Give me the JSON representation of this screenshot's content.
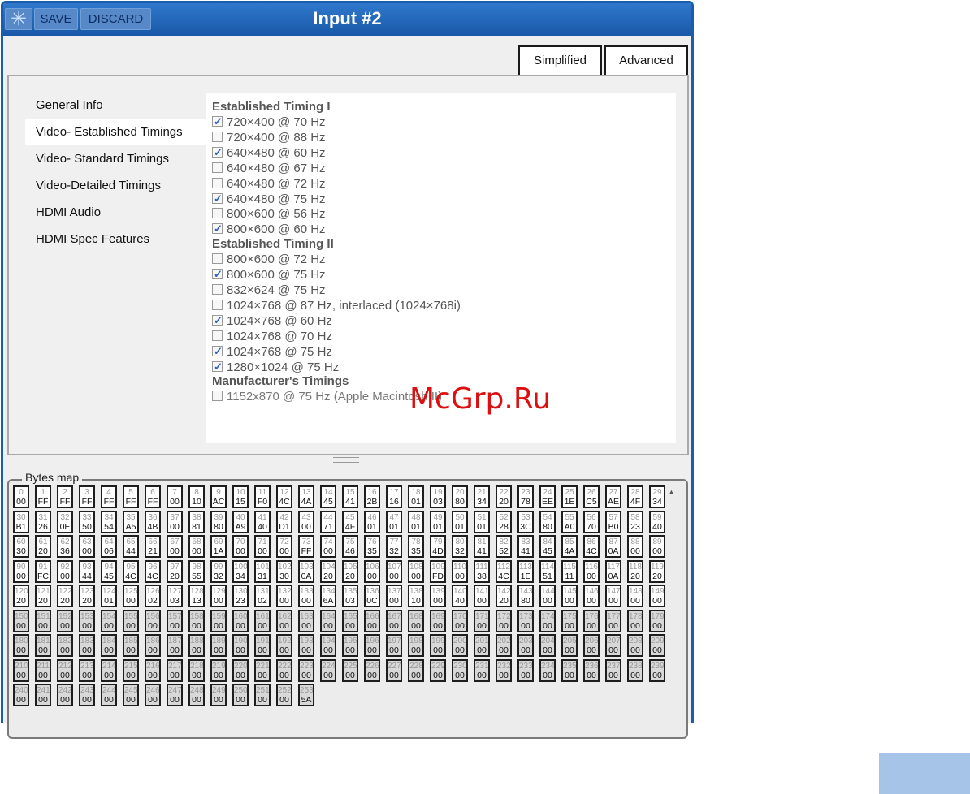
{
  "window": {
    "title": "Input #2",
    "save_label": "SAVE",
    "discard_label": "DISCARD",
    "asterisk": "✳"
  },
  "tabs": {
    "simplified": "Simplified",
    "advanced": "Advanced"
  },
  "nav": {
    "items": [
      {
        "label": "General Info",
        "active": false
      },
      {
        "label": "Video- Established Timings",
        "active": true
      },
      {
        "label": "Video- Standard Timings",
        "active": false
      },
      {
        "label": "Video-Detailed Timings",
        "active": false
      },
      {
        "label": "HDMI Audio",
        "active": false
      },
      {
        "label": "HDMI Spec Features",
        "active": false
      }
    ]
  },
  "timings": {
    "sections": [
      {
        "title": "Established Timing I",
        "options": [
          {
            "label": "720×400 @ 70 Hz",
            "checked": true
          },
          {
            "label": "720×400 @ 88 Hz",
            "checked": false
          },
          {
            "label": "640×480 @ 60 Hz",
            "checked": true
          },
          {
            "label": "640×480 @ 67 Hz",
            "checked": false
          },
          {
            "label": "640×480 @ 72 Hz",
            "checked": false
          },
          {
            "label": "640×480 @ 75 Hz",
            "checked": true
          },
          {
            "label": "800×600 @ 56 Hz",
            "checked": false
          },
          {
            "label": "800×600 @ 60 Hz",
            "checked": true
          }
        ]
      },
      {
        "title": "Established Timing II",
        "options": [
          {
            "label": "800×600 @ 72 Hz",
            "checked": false
          },
          {
            "label": "800×600 @ 75 Hz",
            "checked": true
          },
          {
            "label": "832×624 @ 75 Hz",
            "checked": false
          },
          {
            "label": "1024×768 @ 87 Hz, interlaced (1024×768i)",
            "checked": false
          },
          {
            "label": "1024×768 @ 60 Hz",
            "checked": true
          },
          {
            "label": "1024×768 @ 70 Hz",
            "checked": false
          },
          {
            "label": "1024×768 @ 75 Hz",
            "checked": true
          },
          {
            "label": "1280×1024 @ 75 Hz",
            "checked": true
          }
        ]
      },
      {
        "title": "Manufacturer's Timings",
        "options": [
          {
            "label": "1152x870 @ 75 Hz (Apple Macintosh II)",
            "checked": false,
            "disabled": true
          }
        ]
      }
    ]
  },
  "bytes_map": {
    "legend": "Bytes map",
    "highlight_white": [
      35,
      36,
      37
    ],
    "values": [
      "00",
      "FF",
      "FF",
      "FF",
      "FF",
      "FF",
      "FF",
      "00",
      "10",
      "AC",
      "15",
      "F0",
      "4C",
      "4A",
      "45",
      "41",
      "2B",
      "16",
      "01",
      "03",
      "80",
      "34",
      "20",
      "78",
      "EE",
      "1E",
      "C5",
      "AE",
      "4F",
      "34",
      "B1",
      "26",
      "0E",
      "50",
      "54",
      "A5",
      "4B",
      "00",
      "81",
      "80",
      "A9",
      "40",
      "D1",
      "00",
      "71",
      "4F",
      "01",
      "01",
      "01",
      "01",
      "01",
      "01",
      "28",
      "3C",
      "80",
      "A0",
      "70",
      "B0",
      "23",
      "40",
      "30",
      "20",
      "36",
      "00",
      "06",
      "44",
      "21",
      "00",
      "00",
      "1A",
      "00",
      "00",
      "00",
      "FF",
      "00",
      "46",
      "35",
      "32",
      "35",
      "4D",
      "32",
      "41",
      "52",
      "41",
      "45",
      "4A",
      "4C",
      "0A",
      "00",
      "00",
      "00",
      "FC",
      "00",
      "44",
      "45",
      "4C",
      "4C",
      "20",
      "55",
      "32",
      "34",
      "31",
      "30",
      "0A",
      "20",
      "20",
      "00",
      "00",
      "00",
      "FD",
      "00",
      "38",
      "4C",
      "1E",
      "51",
      "11",
      "00",
      "0A",
      "20",
      "20",
      "20",
      "20",
      "20",
      "20",
      "01",
      "00",
      "02",
      "03",
      "13",
      "00",
      "23",
      "02",
      "00",
      "00",
      "6A",
      "03",
      "0C",
      "00",
      "10",
      "00",
      "40",
      "00",
      "20",
      "80",
      "00",
      "00",
      "00",
      "00",
      "00",
      "00",
      "00",
      "00",
      "00",
      "00",
      "00",
      "00",
      "00",
      "00",
      "00",
      "00",
      "00",
      "00",
      "00",
      "00",
      "00",
      "00",
      "00",
      "00",
      "00",
      "00",
      "00",
      "00",
      "00",
      "00",
      "00",
      "00",
      "00",
      "00",
      "00",
      "00",
      "00",
      "00",
      "00",
      "00",
      "00",
      "00",
      "00",
      "00",
      "00",
      "00",
      "00",
      "00",
      "00",
      "00",
      "00",
      "00",
      "00",
      "00",
      "00",
      "00",
      "00",
      "00",
      "00",
      "00",
      "00",
      "00",
      "00",
      "00",
      "00",
      "00",
      "00",
      "00",
      "00",
      "00",
      "00",
      "00",
      "00",
      "00",
      "00",
      "00",
      "00",
      "00",
      "00",
      "00",
      "00",
      "00",
      "00",
      "00",
      "00",
      "00",
      "00",
      "00",
      "00",
      "00",
      "00",
      "00",
      "00",
      "00",
      "00",
      "00",
      "00",
      "00",
      "00",
      "00",
      "00",
      "00",
      "00",
      "00",
      "00",
      "00",
      "00",
      "00",
      "00",
      "5A"
    ]
  },
  "watermark": "McGrp.Ru",
  "colors": {
    "title_bar": "#1b5dab",
    "checkmark": "#2f5fc0",
    "watermark": "#dc1010"
  }
}
